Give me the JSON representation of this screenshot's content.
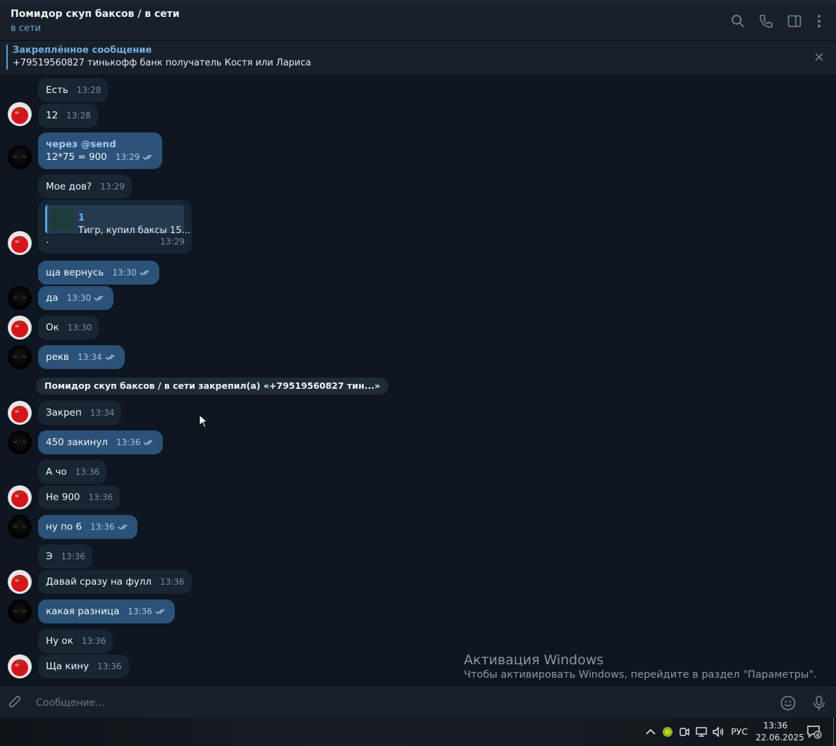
{
  "header": {
    "title": "Помидор скуп баксов / в сети",
    "status": "в сети"
  },
  "pinned": {
    "title": "Закреплённое сообщение",
    "text": "+79519560827 тинькофф банк получатель Костя или Лариса"
  },
  "messages": [
    {
      "text": "Есть",
      "time": "13:28",
      "out": false
    },
    {
      "text": "12",
      "time": "13:28",
      "out": false
    },
    {
      "sender": "через @send",
      "text": "12*75 = 900",
      "time": "13:29",
      "out": true
    },
    {
      "text": "Мое дов?",
      "time": "13:29",
      "out": false
    },
    {
      "quote_name": "1",
      "quote_text": "Тигр, купил баксы 15...",
      "text": ".",
      "time": "13:29",
      "out": false
    },
    {
      "text": "ща вернусь",
      "time": "13:30",
      "out": true
    },
    {
      "text": "да",
      "time": "13:30",
      "out": true
    },
    {
      "text": "Ок",
      "time": "13:30",
      "out": false
    },
    {
      "text": "рекв",
      "time": "13:34",
      "out": true
    },
    {
      "text": "Закреп",
      "time": "13:34",
      "out": false
    },
    {
      "text": "450 закинул",
      "time": "13:36",
      "out": true
    },
    {
      "text": "А чо",
      "time": "13:36",
      "out": false
    },
    {
      "text": "Не 900",
      "time": "13:36",
      "out": false
    },
    {
      "text": "ну по 6",
      "time": "13:36",
      "out": true
    },
    {
      "text": "Э",
      "time": "13:36",
      "out": false
    },
    {
      "text": "Давай сразу на фулл",
      "time": "13:36",
      "out": false
    },
    {
      "text": "какая разница",
      "time": "13:36",
      "out": true
    },
    {
      "text": "Ну ок",
      "time": "13:36",
      "out": false
    },
    {
      "text": "Ща кину",
      "time": "13:36",
      "out": false
    }
  ],
  "service_message": "Помидор скуп баксов / в сети закрепил(а) «+79519560827 тин...»",
  "compose": {
    "placeholder": "Сообщение..."
  },
  "watermark": {
    "title": "Активация Windows",
    "text": "Чтобы активировать Windows, перейдите в раздел \"Параметры\"."
  },
  "taskbar": {
    "lang": "РУС",
    "time": "13:36",
    "date": "22.06.2025",
    "notifications": "4"
  },
  "colors": {
    "background": "#0e1621",
    "incoming_bubble": "#182533",
    "outgoing_bubble": "#2b5278",
    "accent": "#5ba3e0"
  },
  "icons": [
    "search-icon",
    "phone-icon",
    "sidebar-icon",
    "more-icon",
    "close-icon",
    "attach-icon",
    "emoji-icon",
    "mic-icon",
    "tomato-avatar",
    "dark-avatar"
  ]
}
